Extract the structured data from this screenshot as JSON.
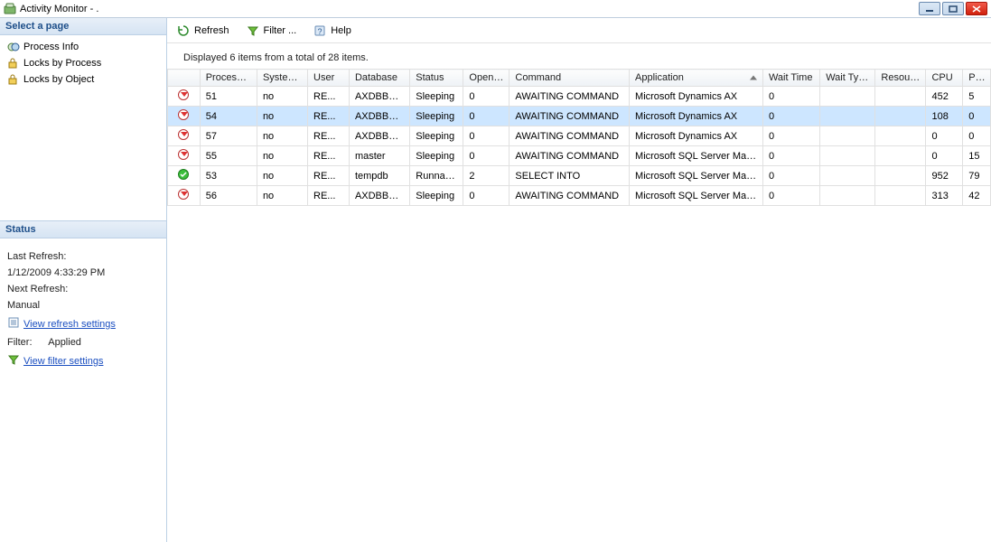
{
  "window": {
    "title": "Activity Monitor - ."
  },
  "sidebar": {
    "select_page_header": "Select a page",
    "pages": [
      {
        "label": "Process Info"
      },
      {
        "label": "Locks by Process"
      },
      {
        "label": "Locks by Object"
      }
    ],
    "status_header": "Status",
    "status": {
      "last_refresh_label": "Last Refresh:",
      "last_refresh_value": "1/12/2009 4:33:29 PM",
      "next_refresh_label": "Next Refresh:",
      "next_refresh_value": "Manual",
      "view_refresh_link": "View refresh settings",
      "filter_label": "Filter:",
      "filter_value": "Applied",
      "view_filter_link": "View filter settings"
    }
  },
  "toolbar": {
    "refresh": "Refresh",
    "filter": "Filter ...",
    "help": "Help"
  },
  "summary": "Displayed 6 items from a total of 28 items.",
  "grid": {
    "columns": [
      "",
      "Process ID",
      "System...",
      "User",
      "Database",
      "Status",
      "Open ...",
      "Command",
      "Application",
      "Wait Time",
      "Wait Type",
      "Resource",
      "CPU",
      "Phy"
    ],
    "rows": [
      {
        "status": "sleep",
        "pid": "51",
        "sys": "no",
        "user": "RE...",
        "db": "AXDBBuild",
        "stat": "Sleeping",
        "open": "0",
        "cmd": "AWAITING COMMAND",
        "app": "Microsoft Dynamics AX",
        "wt": "0",
        "wtype": "",
        "res": "",
        "cpu": "452",
        "phy": "5"
      },
      {
        "status": "sleep",
        "pid": "54",
        "sys": "no",
        "user": "RE...",
        "db": "AXDBBuild",
        "stat": "Sleeping",
        "open": "0",
        "cmd": "AWAITING COMMAND",
        "app": "Microsoft Dynamics AX",
        "wt": "0",
        "wtype": "",
        "res": "",
        "cpu": "108",
        "phy": "0",
        "selected": true
      },
      {
        "status": "sleep",
        "pid": "57",
        "sys": "no",
        "user": "RE...",
        "db": "AXDBBuild",
        "stat": "Sleeping",
        "open": "0",
        "cmd": "AWAITING COMMAND",
        "app": "Microsoft Dynamics AX",
        "wt": "0",
        "wtype": "",
        "res": "",
        "cpu": "0",
        "phy": "0"
      },
      {
        "status": "sleep",
        "pid": "55",
        "sys": "no",
        "user": "RE...",
        "db": "master",
        "stat": "Sleeping",
        "open": "0",
        "cmd": "AWAITING COMMAND",
        "app": "Microsoft SQL Server Man...",
        "wt": "0",
        "wtype": "",
        "res": "",
        "cpu": "0",
        "phy": "15"
      },
      {
        "status": "run",
        "pid": "53",
        "sys": "no",
        "user": "RE...",
        "db": "tempdb",
        "stat": "Runnable",
        "open": "2",
        "cmd": "SELECT INTO",
        "app": "Microsoft SQL Server Man...",
        "wt": "0",
        "wtype": "",
        "res": "",
        "cpu": "952",
        "phy": "79"
      },
      {
        "status": "sleep",
        "pid": "56",
        "sys": "no",
        "user": "RE...",
        "db": "AXDBBuild",
        "stat": "Sleeping",
        "open": "0",
        "cmd": "AWAITING COMMAND",
        "app": "Microsoft SQL Server Man...",
        "wt": "0",
        "wtype": "",
        "res": "",
        "cpu": "313",
        "phy": "42"
      }
    ]
  }
}
